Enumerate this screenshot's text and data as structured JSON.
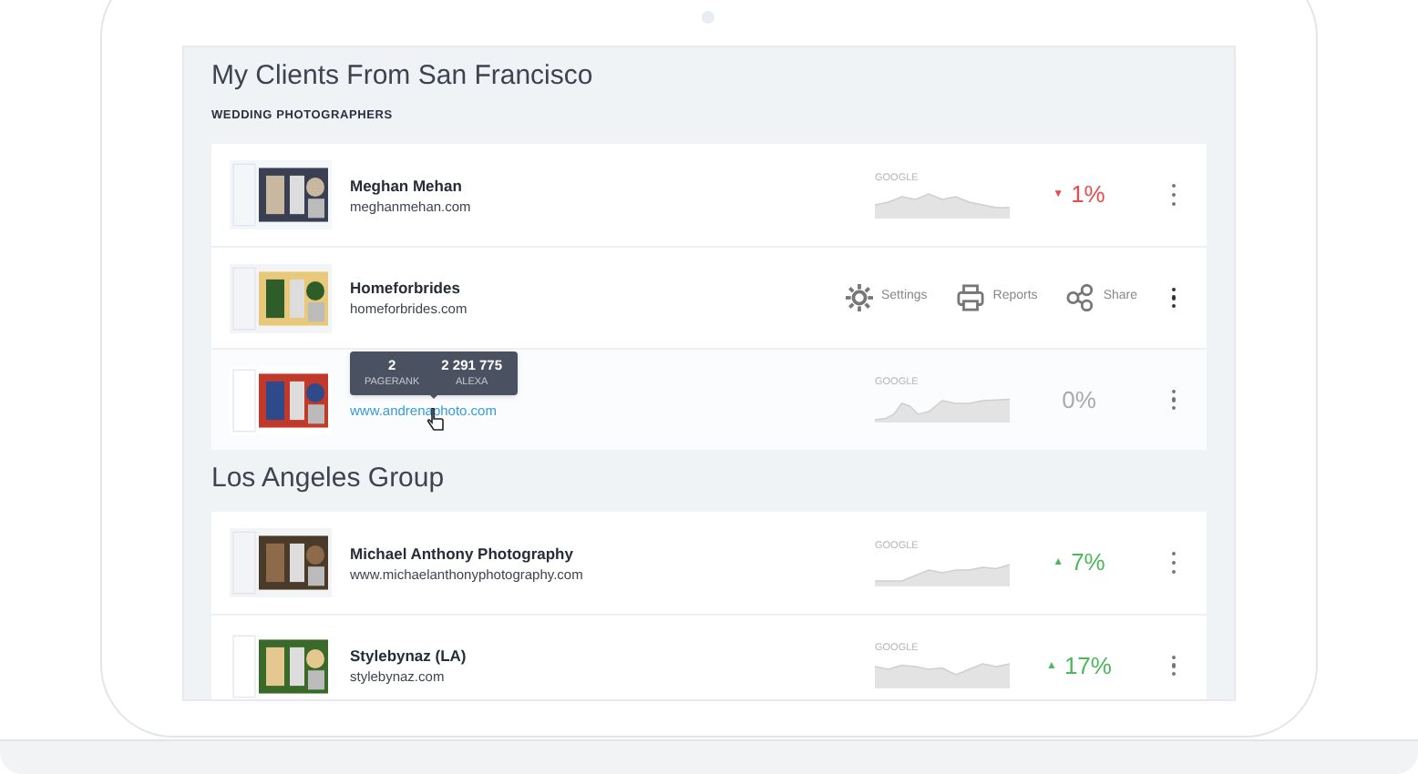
{
  "groups": [
    {
      "title": "My Clients From San Francisco",
      "subtitle": "WEDDING PHOTOGRAPHERS",
      "rows": [
        {
          "kind": "stats",
          "name": "Meghan Mehan",
          "url": "meghanmehan.com",
          "source": "GOOGLE",
          "change": "1%",
          "arrow": "▼",
          "color": "#e74c4c"
        },
        {
          "kind": "actions",
          "name": "Homeforbrides",
          "url": "homeforbrides.com",
          "actions": [
            {
              "kind": "settings",
              "label": "Settings"
            },
            {
              "kind": "reports",
              "label": "Reports"
            },
            {
              "kind": "share",
              "label": "Share"
            }
          ]
        },
        {
          "kind": "stats",
          "url": "www.andrenaphoto.com",
          "link": true,
          "source": "GOOGLE",
          "change": "0%",
          "color": "#aaaaaa",
          "tooltip": [
            {
              "value": "2",
              "label": "PAGERANK"
            },
            {
              "value": "2 291 775",
              "label": "ALEXA"
            }
          ]
        }
      ]
    },
    {
      "title": "Los Angeles Group",
      "rows": [
        {
          "kind": "stats",
          "name": "Michael Anthony Photography",
          "url": "www.michaelanthonyphotography.com",
          "source": "GOOGLE",
          "change": "7%",
          "arrow": "▲",
          "color": "#4cb85c"
        },
        {
          "kind": "stats",
          "name": "Stylebynaz (LA)",
          "url": "stylebynaz.com",
          "source": "GOOGLE",
          "change": "17%",
          "arrow": "▲",
          "color": "#4cb85c"
        }
      ]
    }
  ]
}
